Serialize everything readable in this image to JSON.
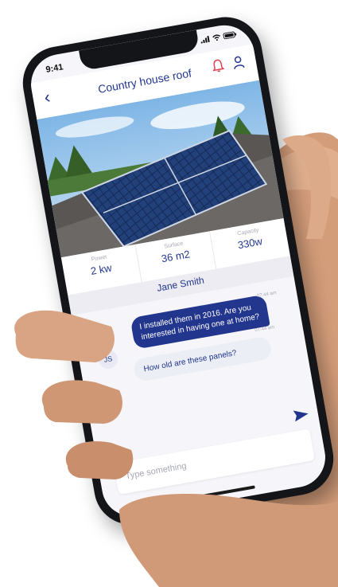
{
  "status": {
    "time": "9:41"
  },
  "header": {
    "title": "Country house roof",
    "icons": [
      "back-arrow",
      "bell-icon",
      "user-icon"
    ]
  },
  "stats": [
    {
      "label": "Power",
      "value": "2 kw"
    },
    {
      "label": "Surface",
      "value": "36 m2"
    },
    {
      "label": "Capacity",
      "value": "330w"
    }
  ],
  "contact": {
    "name": "Jane  Smith",
    "initials": "JS"
  },
  "messages": [
    {
      "text": "I installed them in 2016. Are you interested in having one at home?",
      "time": "07:44 am",
      "direction": "outgoing"
    },
    {
      "text": "How old are these panels?",
      "time": "07:44 am",
      "direction": "incoming"
    }
  ],
  "composer": {
    "placeholder": "Type something",
    "value": ""
  },
  "colors": {
    "accent": "#23368e",
    "muted": "#a7a8b5",
    "bubble_in": "#eceef6"
  }
}
